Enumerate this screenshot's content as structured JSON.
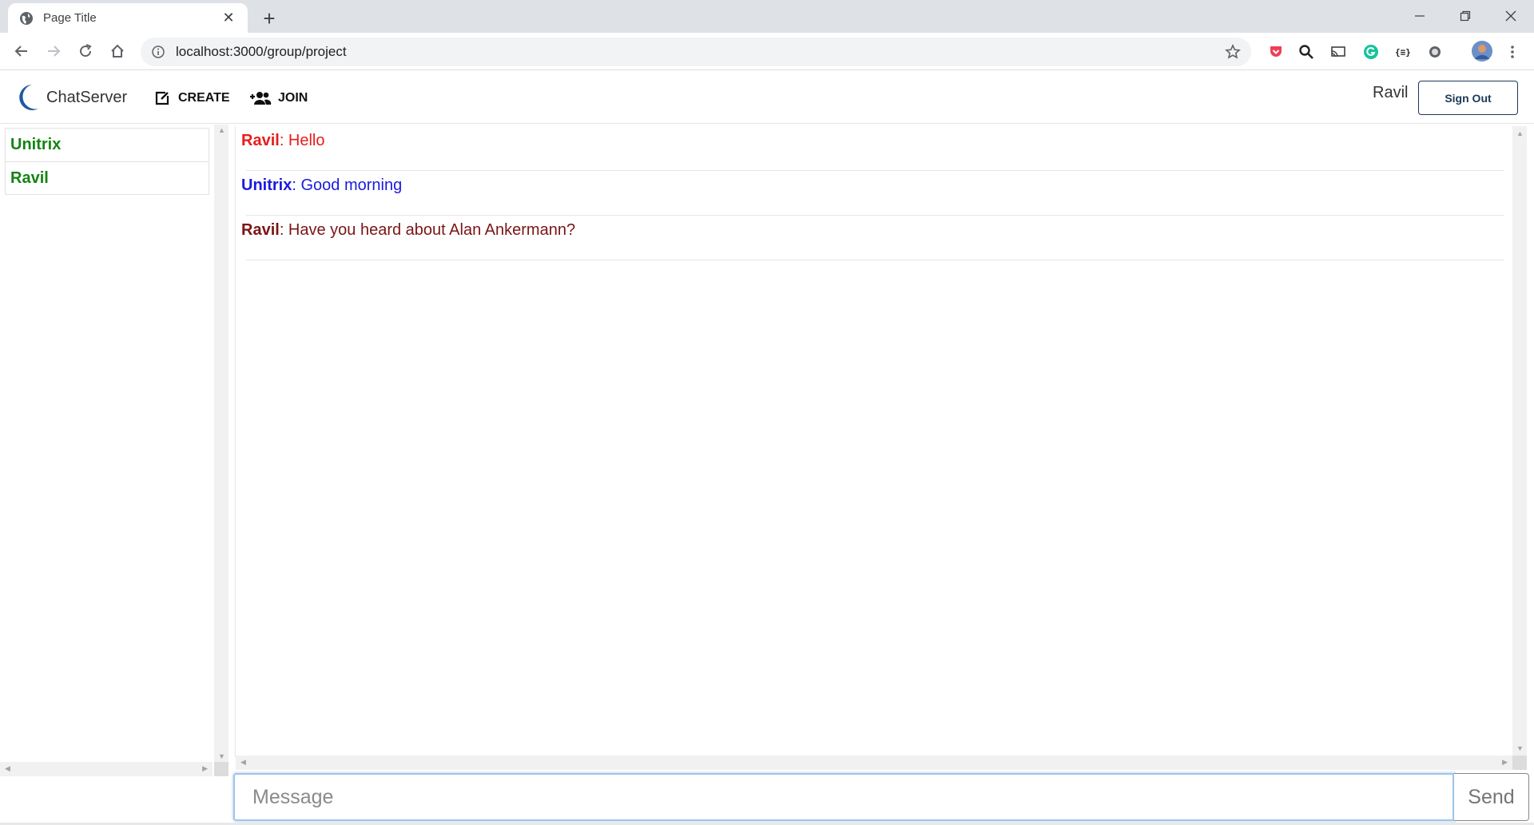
{
  "browser": {
    "tab_title": "Page Title",
    "url": "localhost:3000/group/project"
  },
  "app": {
    "brand": "ChatServer",
    "nav": {
      "create_label": "CREATE",
      "join_label": "JOIN"
    },
    "user": "Ravil",
    "signout_label": "Sign Out"
  },
  "sidebar": {
    "members": [
      {
        "name": "Unitrix"
      },
      {
        "name": "Ravil"
      }
    ]
  },
  "chat": {
    "messages": [
      {
        "author": "Ravil",
        "text": ": Hello",
        "color": "#e81c1c"
      },
      {
        "author": "Unitrix",
        "text": ": Good morning",
        "color": "#1a1ae0"
      },
      {
        "author": "Ravil",
        "text": ": Have you heard about Alan Ankermann?",
        "color": "#7a1515"
      }
    ]
  },
  "composer": {
    "placeholder": "Message",
    "send_label": "Send"
  },
  "colors": {
    "member_name": "#138313",
    "signout_border": "#1b3a57",
    "input_focus": "#9fc3ec"
  }
}
